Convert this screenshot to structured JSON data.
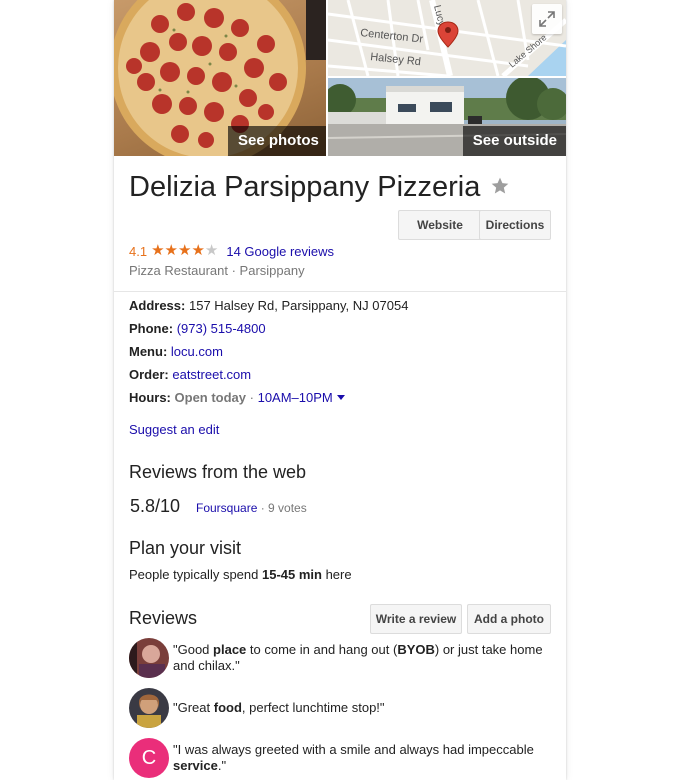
{
  "photos": {
    "see_photos_label": "See photos",
    "see_outside_label": "See outside",
    "map_streets": [
      "Centerton Dr",
      "Halsey Rd",
      "Lucy Rd",
      "Lake Shore"
    ]
  },
  "place": {
    "name": "Delizia Parsippany Pizzeria",
    "rating": "4.1",
    "stars_filled": 4,
    "stars_total": 5,
    "reviews_link": "14 Google reviews",
    "category": "Pizza Restaurant · Parsippany"
  },
  "actions": {
    "website_label": "Website",
    "directions_label": "Directions"
  },
  "details": {
    "address_label": "Address:",
    "address_value": "157 Halsey Rd, Parsippany, NJ 07054",
    "phone_label": "Phone:",
    "phone_value": "(973) 515-4800",
    "menu_label": "Menu:",
    "menu_value": "locu.com",
    "order_label": "Order:",
    "order_value": "eatstreet.com",
    "hours_label": "Hours:",
    "hours_status": "Open today",
    "hours_separator": " · ",
    "hours_value": "10AM–10PM"
  },
  "suggest_edit": "Suggest an edit",
  "web_reviews": {
    "title": "Reviews from the web",
    "score": "5.8/10",
    "source": "Foursquare",
    "votes": " · 9 votes"
  },
  "plan": {
    "title": "Plan your visit",
    "prefix": "People typically spend ",
    "duration": "15-45 min",
    "suffix": " here"
  },
  "reviews": {
    "title": "Reviews",
    "write_label": "Write a review",
    "add_photo_label": "Add a photo",
    "items": [
      {
        "parts": [
          "\"Good ",
          "place",
          " to come in and hang out (",
          "BYOB",
          ") or just take home and chilax.\""
        ]
      },
      {
        "parts": [
          "\"Great ",
          "food",
          ", perfect lunchtime stop!\""
        ]
      },
      {
        "avatar_letter": "C",
        "parts": [
          "\"I was always greeted with a smile and always had impeccable ",
          "service",
          ".\""
        ]
      }
    ]
  },
  "colors": {
    "link": "#1a0dab",
    "rating_orange": "#e7711b",
    "avatar_pink": "#ea2e7a"
  }
}
